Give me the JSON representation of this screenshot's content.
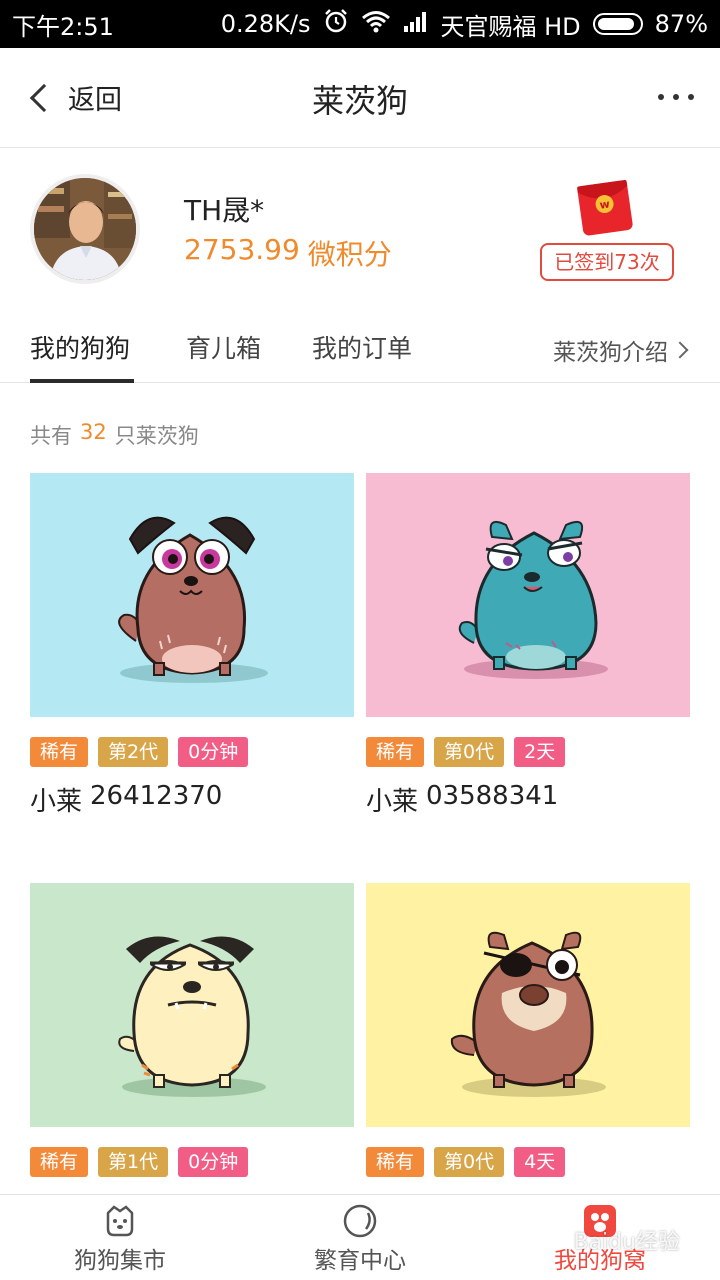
{
  "status_bar": {
    "time": "下午2:51",
    "speed": "0.28K/s",
    "carrier": "天官赐福 HD",
    "battery": "87%"
  },
  "nav": {
    "back_label": "返回",
    "title": "莱茨狗"
  },
  "profile": {
    "name": "TH晟*",
    "points_value": "2753.99",
    "points_unit": "微积分",
    "checkin_label": "已签到73次"
  },
  "tabs": [
    {
      "label": "我的狗狗",
      "active": true
    },
    {
      "label": "育儿箱",
      "active": false
    },
    {
      "label": "我的订单",
      "active": false
    }
  ],
  "intro_link": "莱茨狗介绍",
  "count": {
    "prefix": "共有",
    "number": "32",
    "suffix": "只莱茨狗"
  },
  "dogs": [
    {
      "bg": "#b4e9f3",
      "rarity": "稀有",
      "generation": "第2代",
      "time": "0分钟",
      "name_prefix": "小莱",
      "id": "26412370"
    },
    {
      "bg": "#f7bcd2",
      "rarity": "稀有",
      "generation": "第0代",
      "time": "2天",
      "name_prefix": "小莱",
      "id": "03588341"
    },
    {
      "bg": "#c9e7cb",
      "rarity": "稀有",
      "generation": "第1代",
      "time": "0分钟",
      "name_prefix": "",
      "id": ""
    },
    {
      "bg": "#fff3a3",
      "rarity": "稀有",
      "generation": "第0代",
      "time": "4天",
      "name_prefix": "",
      "id": ""
    }
  ],
  "bottom_nav": [
    {
      "label": "狗狗集市",
      "icon": "dog-face-icon",
      "active": false
    },
    {
      "label": "繁育中心",
      "icon": "circle-icon",
      "active": false
    },
    {
      "label": "我的狗窝",
      "icon": "kennel-icon",
      "active": true
    }
  ],
  "watermark": "Baidu经验",
  "colors": {
    "accent_orange": "#f08a2c",
    "accent_red": "#f0483e",
    "tag_rare": "#f28a3a",
    "tag_generation": "#d8a548",
    "tag_time": "#f25d86"
  }
}
